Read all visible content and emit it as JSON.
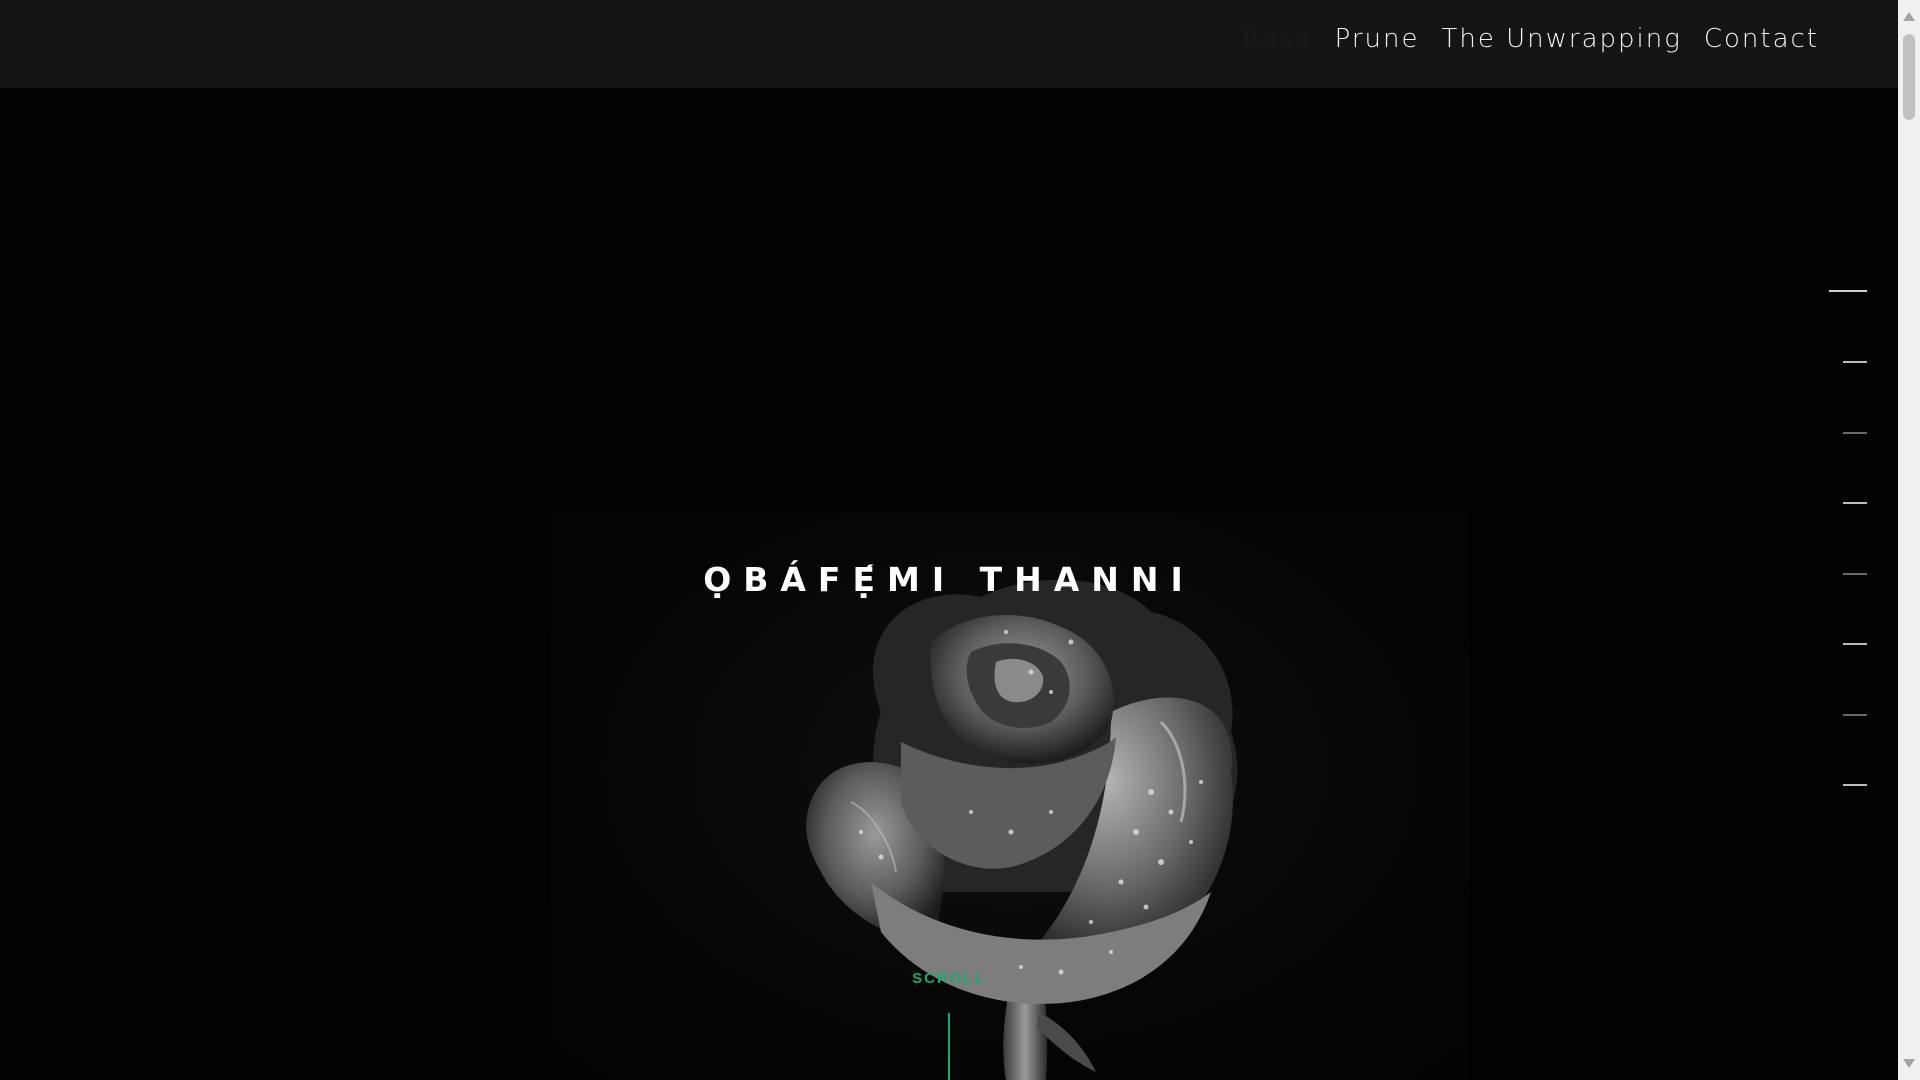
{
  "nav": {
    "items": [
      {
        "label": "Rosa",
        "active": true
      },
      {
        "label": "Prune",
        "active": false
      },
      {
        "label": "The Unwrapping",
        "active": false
      },
      {
        "label": "Contact",
        "active": false
      }
    ]
  },
  "hero": {
    "title": "ỌBÁFẸ́MI THANNI",
    "image": "black-and-white-rose-with-water-droplets"
  },
  "scroll": {
    "label": "SCROLL"
  },
  "section_nav": {
    "count": 8,
    "active_index": 0
  },
  "colors": {
    "accent": "#1aa86b",
    "navbar": "#141414",
    "background": "#020202",
    "nav_active": "#1f1f1f"
  }
}
